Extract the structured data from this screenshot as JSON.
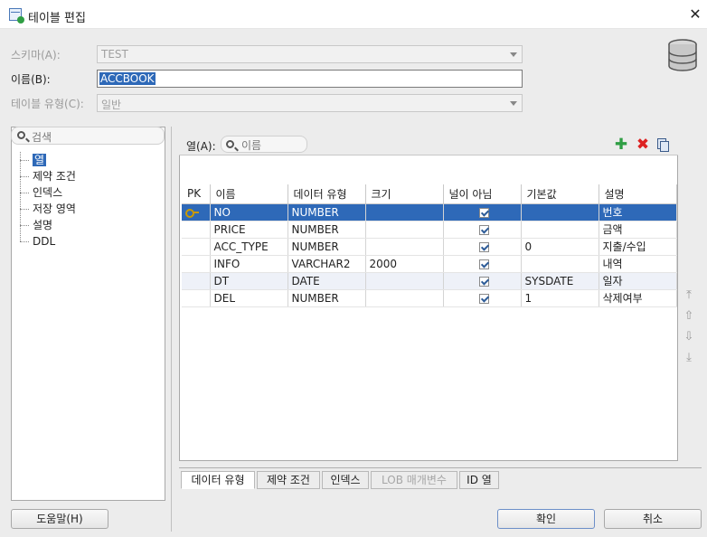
{
  "window": {
    "title": "테이블 편집",
    "close_glyph": "✕"
  },
  "form": {
    "schema_label": "스키마(A):",
    "schema_value": "TEST",
    "name_label": "이름(B):",
    "name_value": "ACCBOOK",
    "table_type_label": "테이블 유형(C):",
    "table_type_value": "일반"
  },
  "search": {
    "placeholder": "검색"
  },
  "tree": {
    "items": [
      {
        "label": "열",
        "selected": true
      },
      {
        "label": "제약 조건"
      },
      {
        "label": "인덱스"
      },
      {
        "label": "저장 영역"
      },
      {
        "label": "설명"
      },
      {
        "label": "DDL"
      }
    ]
  },
  "columns_panel": {
    "label": "열(A):",
    "search_placeholder": "이름",
    "add_icon": "plus-icon",
    "delete_icon": "x-icon",
    "copy_icon": "copy-icon"
  },
  "grid": {
    "headers": [
      "PK",
      "이름",
      "데이터 유형",
      "크기",
      "널이 아님",
      "기본값",
      "설명"
    ],
    "rows": [
      {
        "pk": true,
        "name": "NO",
        "type": "NUMBER",
        "size": "",
        "not_null": true,
        "default": "",
        "comment": "번호",
        "selected": true
      },
      {
        "pk": false,
        "name": "PRICE",
        "type": "NUMBER",
        "size": "",
        "not_null": true,
        "default": "",
        "comment": "금액"
      },
      {
        "pk": false,
        "name": "ACC_TYPE",
        "type": "NUMBER",
        "size": "",
        "not_null": true,
        "default": "0",
        "comment": "지출/수입"
      },
      {
        "pk": false,
        "name": "INFO",
        "type": "VARCHAR2",
        "size": "2000",
        "not_null": true,
        "default": "",
        "comment": "내역"
      },
      {
        "pk": false,
        "name": "DT",
        "type": "DATE",
        "size": "",
        "not_null": true,
        "default": "SYSDATE",
        "comment": "일자",
        "alt": true
      },
      {
        "pk": false,
        "name": "DEL",
        "type": "NUMBER",
        "size": "",
        "not_null": true,
        "default": "1",
        "comment": "삭제여부"
      }
    ]
  },
  "side_buttons": {
    "top_glyph": "⤒",
    "up_glyph": "⇧",
    "down_glyph": "⇩",
    "bottom_glyph": "⤓"
  },
  "tabs": [
    {
      "label": "데이터 유형",
      "active": true
    },
    {
      "label": "제약 조건"
    },
    {
      "label": "인덱스"
    },
    {
      "label": "LOB 매개변수",
      "disabled": true
    },
    {
      "label": "ID 열"
    }
  ],
  "buttons": {
    "help": "도움말(H)",
    "ok": "확인",
    "cancel": "취소"
  },
  "colors": {
    "selection": "#2e69b8",
    "add": "#2f9e44",
    "delete": "#dd2222"
  }
}
